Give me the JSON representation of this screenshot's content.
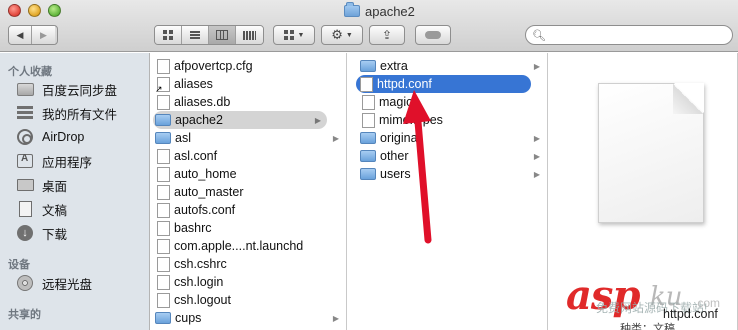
{
  "window": {
    "title": "apache2"
  },
  "toolbar": {
    "back": "◀",
    "forward": "▶"
  },
  "sidebar": {
    "favorites_heading": "个人收藏",
    "favorites": [
      "百度云同步盘",
      "我的所有文件",
      "AirDrop",
      "应用程序",
      "桌面",
      "文稿",
      "下载"
    ],
    "devices_heading": "设备",
    "devices": [
      "远程光盘"
    ],
    "shared_heading": "共享的"
  },
  "column1": {
    "items": [
      "afpovertcp.cfg",
      "aliases",
      "aliases.db",
      "apache2",
      "asl",
      "asl.conf",
      "auto_home",
      "auto_master",
      "autofs.conf",
      "bashrc",
      "com.apple....nt.launchd",
      "csh.cshrc",
      "csh.login",
      "csh.logout",
      "cups"
    ],
    "selected": "apache2"
  },
  "column2": {
    "items": [
      "extra",
      "httpd.conf",
      "magic",
      "mime.types",
      "original",
      "other",
      "users"
    ],
    "selected": "httpd.conf"
  },
  "preview": {
    "filename": "httpd.conf",
    "subtitle": "种类：文稿"
  },
  "watermark": {
    "logo_main": "asp",
    "logo_ku": "ku",
    "logo_com": ".com",
    "caption": "免费网站源码下载站!"
  },
  "colors": {
    "selection_blue": "#3775d4",
    "arrow_red": "#e0102a",
    "watermark_red": "#e02a2a"
  }
}
